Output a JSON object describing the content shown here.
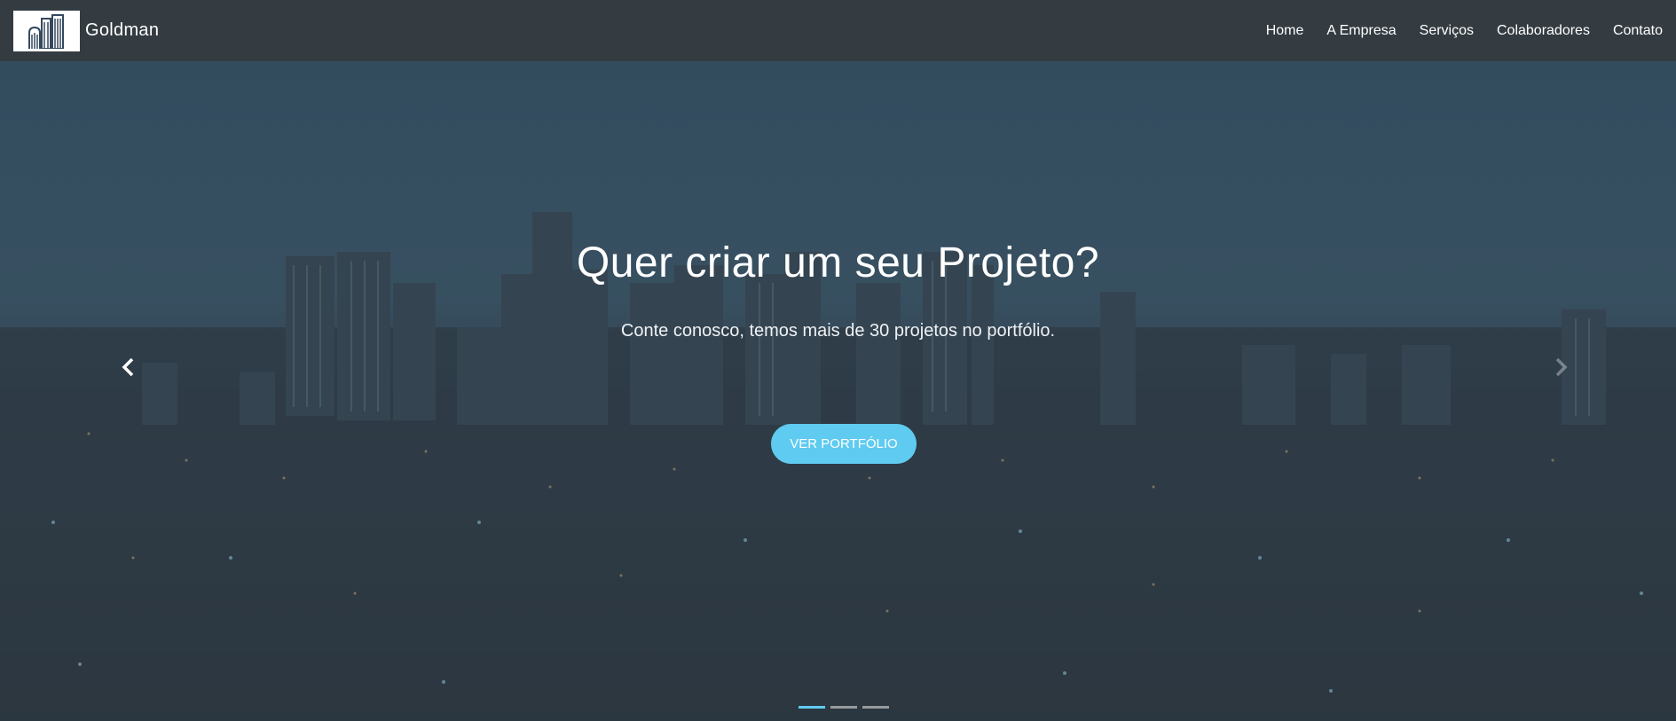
{
  "navbar": {
    "brand": "Goldman",
    "links": [
      "Home",
      "A Empresa",
      "Serviços",
      "Colaboradores",
      "Contato"
    ]
  },
  "hero": {
    "headline": "Quer criar um seu Projeto?",
    "subline": "Conte conosco, temos mais de 30 projetos no portfólio.",
    "cta_label": "VER PORTFÓLIO",
    "slide_count": 3,
    "active_slide": 1
  },
  "icons": {
    "logo": "buildings-icon",
    "prev": "chevron-left-icon",
    "next": "chevron-right-icon"
  },
  "colors": {
    "navbar_bg": "#343c42",
    "accent": "#5fcbf0"
  }
}
